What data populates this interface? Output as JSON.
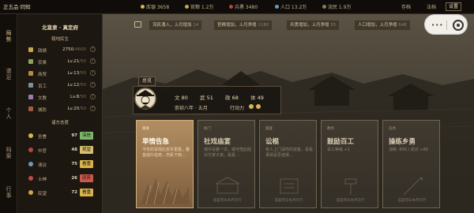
{
  "topbar": {
    "title": "正五品·同知",
    "stats": [
      {
        "label": "库银 3658",
        "color": "#d9b552"
      },
      {
        "label": "官粮 1.2万",
        "color": "#c9a64a"
      },
      {
        "label": "兵勇 3480",
        "color": "#b04a3a"
      },
      {
        "label": "人口 13.2万",
        "color": "#6a9abf"
      },
      {
        "label": "流民 1.9万",
        "color": "#8a7a60"
      }
    ],
    "buttons": [
      "存档",
      "法档",
      "设置"
    ]
  },
  "leftnav": [
    {
      "label": "局势",
      "active": true
    },
    {
      "label": "谱足",
      "active": false
    },
    {
      "label": "个人",
      "active": false
    },
    {
      "label": "档案",
      "active": false
    },
    {
      "label": "行事",
      "active": false
    }
  ],
  "panel": {
    "title": "北直隶 · 真定府",
    "section1": "辖地民生",
    "stats": [
      {
        "label": "政绩",
        "value": "2750",
        "max": "/4600",
        "color": "#c9a64a"
      },
      {
        "label": "农桑",
        "value": "Lv.21",
        "max": "/50",
        "color": "#8aa35a"
      },
      {
        "label": "商贸",
        "value": "Lv.13",
        "max": "/50",
        "color": "#b8893e"
      },
      {
        "label": "百工",
        "value": "Lv.12",
        "max": "/50",
        "color": "#7a8ea6"
      },
      {
        "label": "文教",
        "value": "Lv.8",
        "max": "/50",
        "color": "#9a7ab0"
      },
      {
        "label": "城防",
        "value": "Lv.20",
        "max": "/50",
        "color": "#a05a48"
      }
    ],
    "section2": "诸方态度",
    "factions": [
      {
        "label": "圣眷",
        "value": "97",
        "status": "深信",
        "color": "#d9b552",
        "status_color": "#7db56a"
      },
      {
        "label": "中官",
        "value": "48",
        "status": "观望",
        "color": "#b04a3a",
        "status_color": "#d8c06a"
      },
      {
        "label": "清议",
        "value": "75",
        "status": "看重",
        "color": "#6a9abf",
        "status_color": "#d8b24a"
      },
      {
        "label": "士绅",
        "value": "26",
        "status": "厌弃",
        "color": "#c04a40",
        "status_color": "#c9574a"
      },
      {
        "label": "民望",
        "value": "72",
        "status": "看重",
        "color": "#c9a64a",
        "status_color": "#d8b24a"
      }
    ]
  },
  "notifications": [
    {
      "text": "流民涌入，上月增加",
      "value": "14"
    },
    {
      "text": "官粮增加，上月净增",
      "value": "1180"
    },
    {
      "text": "兵勇增加，上月净增",
      "value": "55"
    },
    {
      "text": "人口增加，上月净增",
      "value": "648"
    }
  ],
  "leader": {
    "tag": "总览",
    "stats": [
      {
        "label": "文",
        "value": "80"
      },
      {
        "label": "武",
        "value": "51"
      },
      {
        "label": "政",
        "value": "68"
      },
      {
        "label": "体",
        "value": "49"
      }
    ],
    "date": "崇祯八年 · 五月",
    "action_label": "行动力",
    "action_points": 2
  },
  "cards": [
    {
      "kind": "重要",
      "name": "旱情告急",
      "desc": "今年的旱情比去冬更甚，春苗成片枯死…市民下田…",
      "footer": "",
      "active": true
    },
    {
      "kind": "拆门",
      "name": "社戏庙宴",
      "desc": "城中设宴一次，或可借此结识方家子弟，看看…",
      "footer": "庙宴完毕本月可行",
      "active": false
    },
    {
      "kind": "家宴",
      "name": "讼棍",
      "desc": "有人上门请你的说客，看看事情是否值得…",
      "footer": "庙宴完毕本月可行",
      "active": false
    },
    {
      "kind": "政务",
      "name": "鼓励百工",
      "desc": "百工等级 +1",
      "footer": "庙宴完毕本月可行",
      "active": false
    },
    {
      "kind": "兵务",
      "name": "操练乡勇",
      "desc": "消耗 -800 / 武识 +80",
      "footer": "庙宴完毕本月可行",
      "active": false
    }
  ]
}
